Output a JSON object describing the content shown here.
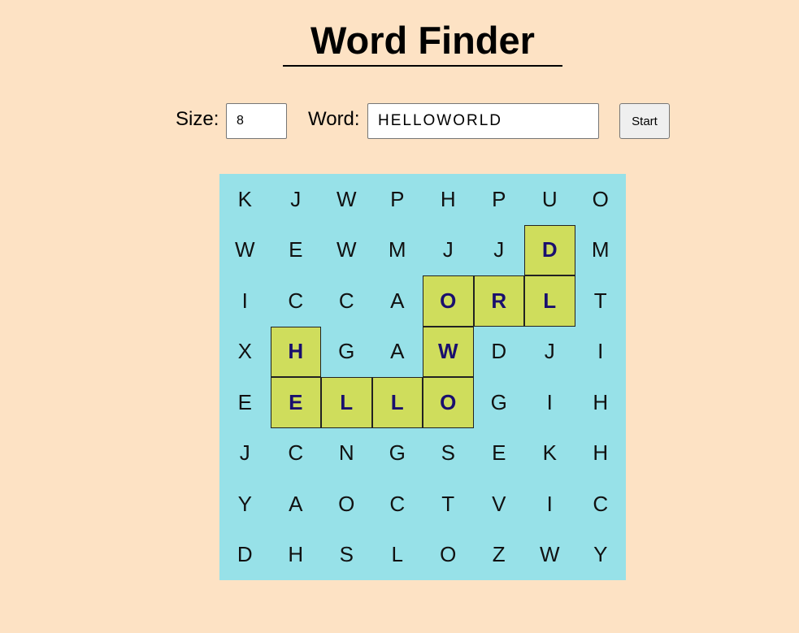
{
  "title": "Word Finder",
  "controls": {
    "size_label": "Size:",
    "size_value": "8",
    "word_label": "Word:",
    "word_value": "HELLOWORLD",
    "start_label": "Start"
  },
  "colors": {
    "background": "#fde2c4",
    "grid_background": "#97e1e8",
    "highlight_fill": "#cfdd5c",
    "highlight_text": "#1a0f6e",
    "letter_text": "#111111",
    "button_background": "#efefef"
  },
  "grid": {
    "size": 8,
    "rows": [
      [
        "K",
        "J",
        "W",
        "P",
        "H",
        "P",
        "U",
        "O"
      ],
      [
        "W",
        "E",
        "W",
        "M",
        "J",
        "J",
        "D",
        "M"
      ],
      [
        "I",
        "C",
        "C",
        "A",
        "O",
        "R",
        "L",
        "T"
      ],
      [
        "X",
        "H",
        "G",
        "A",
        "W",
        "D",
        "J",
        "I"
      ],
      [
        "E",
        "E",
        "L",
        "L",
        "O",
        "G",
        "I",
        "H"
      ],
      [
        "J",
        "C",
        "N",
        "G",
        "S",
        "E",
        "K",
        "H"
      ],
      [
        "Y",
        "A",
        "O",
        "C",
        "T",
        "V",
        "I",
        "C"
      ],
      [
        "D",
        "H",
        "S",
        "L",
        "O",
        "Z",
        "W",
        "Y"
      ]
    ],
    "highlighted_path": [
      [
        3,
        1
      ],
      [
        4,
        1
      ],
      [
        4,
        2
      ],
      [
        4,
        3
      ],
      [
        4,
        4
      ],
      [
        3,
        4
      ],
      [
        2,
        4
      ],
      [
        2,
        5
      ],
      [
        2,
        6
      ],
      [
        1,
        6
      ]
    ]
  }
}
